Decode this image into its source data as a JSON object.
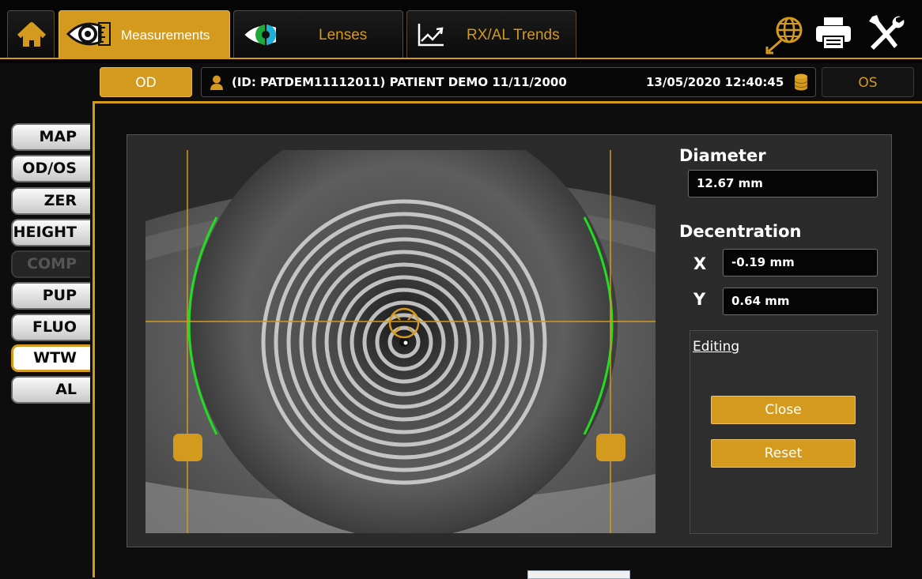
{
  "colors": {
    "accent": "#d39a1e",
    "limbus": "#22dd22",
    "background": "#0d0d0d"
  },
  "toolbar": {
    "tabs": [
      {
        "label": "Measurements",
        "icon": "eye-measure-icon",
        "active": true
      },
      {
        "label": "Lenses",
        "icon": "eye-lens-icon",
        "active": false
      },
      {
        "label": "RX/AL Trends",
        "icon": "trend-chart-icon",
        "active": false
      }
    ],
    "icons": [
      "home-icon",
      "globe-icon",
      "printer-icon",
      "tools-icon"
    ]
  },
  "patient": {
    "od_label": "OD",
    "os_label": "OS",
    "info": "(ID: PATDEM11112011) PATIENT DEMO 11/11/2000",
    "datetime": "13/05/2020 12:40:45"
  },
  "sidenav": {
    "items": [
      {
        "label": "MAP",
        "state": "normal"
      },
      {
        "label": "OD/OS",
        "state": "normal"
      },
      {
        "label": "ZER",
        "state": "normal"
      },
      {
        "label": "HEIGHT",
        "state": "normal"
      },
      {
        "label": "COMP",
        "state": "disabled"
      },
      {
        "label": "PUP",
        "state": "normal"
      },
      {
        "label": "FLUO",
        "state": "normal"
      },
      {
        "label": "WTW",
        "state": "active"
      },
      {
        "label": "AL",
        "state": "normal"
      }
    ]
  },
  "measurements": {
    "diameter_label": "Diameter",
    "diameter_value": "12.67 mm",
    "decentration_label": "Decentration",
    "x_label": "X",
    "x_value": "-0.19 mm",
    "y_label": "Y",
    "y_value": "0.64 mm"
  },
  "editing": {
    "label": "Editing",
    "close_label": "Close",
    "reset_label": "Reset"
  }
}
